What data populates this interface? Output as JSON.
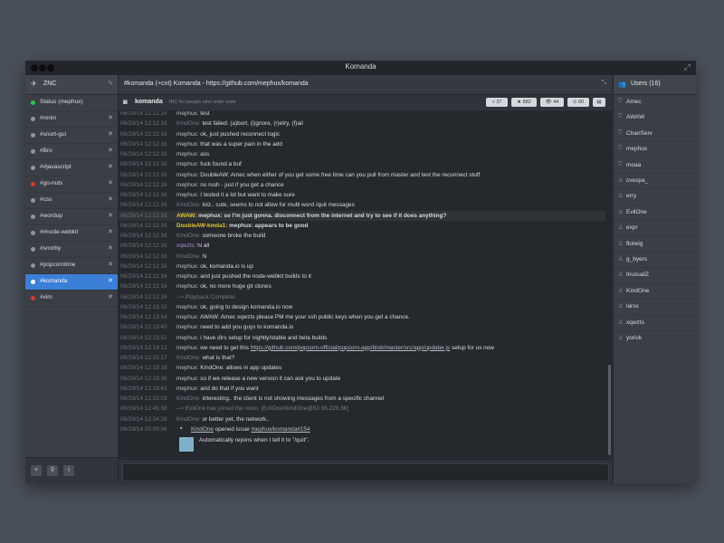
{
  "window": {
    "title": "Komanda"
  },
  "sidebar": {
    "network": {
      "label": "ZNC"
    },
    "channels": [
      {
        "label": "Status (mephux)",
        "dot": "#2ec44a",
        "close": "",
        "active": false
      },
      {
        "label": "#ronin",
        "dot": "#8f969c",
        "close": "✕",
        "active": false
      },
      {
        "label": "#snort-gui",
        "dot": "#8f969c",
        "close": "✕",
        "active": false
      },
      {
        "label": "#Bro",
        "dot": "#8f969c",
        "close": "✕",
        "active": false
      },
      {
        "label": "##javascript",
        "dot": "#8f969c",
        "close": "✕",
        "active": false
      },
      {
        "label": "#go-nuts",
        "dot": "#d8392b",
        "close": "✕",
        "active": false
      },
      {
        "label": "#css",
        "dot": "#8f969c",
        "close": "✕",
        "active": false
      },
      {
        "label": "#wordup",
        "dot": "#8f969c",
        "close": "✕",
        "active": false
      },
      {
        "label": "##node-webkit",
        "dot": "#8f969c",
        "close": "✕",
        "active": false
      },
      {
        "label": "#snorby",
        "dot": "#8f969c",
        "close": "✕",
        "active": false
      },
      {
        "label": "#popcorntime",
        "dot": "#8f969c",
        "close": "✕",
        "active": false
      },
      {
        "label": "#komanda",
        "dot": "#ffffff",
        "close": "✕",
        "active": true
      },
      {
        "label": "#vim",
        "dot": "#d8392b",
        "close": "✕",
        "active": false
      }
    ],
    "footer_buttons": [
      "+",
      "⚲",
      "i"
    ]
  },
  "topic": {
    "text": "#komanda (+cnt) Komanda - https://github.com/mephux/komanda"
  },
  "github": {
    "name": "komanda",
    "description": "IRC for people who write code",
    "stats": [
      {
        "icon": "⑂",
        "value": "37"
      },
      {
        "icon": "★",
        "value": "882"
      },
      {
        "icon": "👁",
        "value": "44"
      },
      {
        "icon": "⊙",
        "value": "60"
      },
      {
        "icon": "▤",
        "value": ""
      }
    ]
  },
  "messages": [
    {
      "ts": "06/29/14 12:12:16",
      "nick": "mephux:",
      "text": "test"
    },
    {
      "ts": "06/29/14 12:12:16",
      "nick": "KindOne:",
      "text": "test failed. (a)bort, (i)gnore, (r)etry, (f)ail",
      "muted_nick": true
    },
    {
      "ts": "06/29/14 12:12:16",
      "nick": "mephux:",
      "text": "ok, just pushed reconnect logic"
    },
    {
      "ts": "06/29/14 12:12:16",
      "nick": "mephux:",
      "text": "that was a super pain in the add"
    },
    {
      "ts": "06/29/14 12:12:16",
      "nick": "mephux:",
      "text": "ass"
    },
    {
      "ts": "06/29/14 12:12:16",
      "nick": "mephux:",
      "text": "fuck found a buf"
    },
    {
      "ts": "06/29/14 12:12:16",
      "nick": "mephux:",
      "text": "DoubleAW: Amec when either of you get some free time can you pull from master and test the reconnect stuff"
    },
    {
      "ts": "06/29/14 12:12:16",
      "nick": "mephux:",
      "text": "no rush - just if you get a chance"
    },
    {
      "ts": "06/29/14 12:12:16",
      "nick": "mephux:",
      "text": "I tested it a lot but want to make sure"
    },
    {
      "ts": "06/29/14 12:12:16",
      "nick": "KindOne:",
      "text": "lolz.. cute, seems to not allow for multi word /quit messages",
      "muted_nick": true
    },
    {
      "ts": "06/29/14 12:12:16",
      "nick": "AWAW:",
      "text": "mephux: so I'm just gonna. disconnect from the internet and try to see if it does anything?",
      "yellow": true,
      "hl": true
    },
    {
      "ts": "06/29/14 12:12:16",
      "nick": "DoubleAW-kmda1:",
      "text": "mephux: appears to be good",
      "yellow": true
    },
    {
      "ts": "06/29/14 12:12:16",
      "nick": "KindOne:",
      "text": "someone broke the build",
      "muted_nick": true
    },
    {
      "ts": "06/29/14 12:12:16",
      "nick": "xqwzts:",
      "text": "hi all",
      "purple": true
    },
    {
      "ts": "06/29/14 12:12:16",
      "nick": "KindOne:",
      "text": "hi",
      "muted_nick": true
    },
    {
      "ts": "06/29/14 12:12:16",
      "nick": "mephux:",
      "text": "ok, komanda.io is up"
    },
    {
      "ts": "06/29/14 12:12:16",
      "nick": "mephux:",
      "text": "and just pushed the node-webkit builds to it"
    },
    {
      "ts": "06/29/14 12:12:16",
      "nick": "mephux:",
      "text": "ok, no more huge git clones"
    },
    {
      "ts": "06/29/14 12:12:16",
      "nick": "-->",
      "text": "Playback Complete.",
      "system": true
    },
    {
      "ts": "06/29/14 12:13:10",
      "nick": "mephux:",
      "text": "ok, going to design komanda.io now"
    },
    {
      "ts": "06/29/14 12:13:34",
      "nick": "mephux:",
      "text": "AWAW: Amec xqwzts please PM me your ssh public keys when you get a chance."
    },
    {
      "ts": "06/29/14 12:13:40",
      "nick": "mephux:",
      "text": "need to add you guys to komanda.io"
    },
    {
      "ts": "06/29/14 12:13:51",
      "nick": "mephux:",
      "text": "i have dirs setup for nightly/stable and beta builds"
    },
    {
      "ts": "06/29/14 12:14:12",
      "nick": "mephux:",
      "text_pre": "we need to get this ",
      "link": "https://github.com/popcorn-official/popcorn-app/blob/master/src/app/updater.js",
      "text_post": " setup for us now"
    },
    {
      "ts": "06/29/14 12:15:17",
      "nick": "KindOne:",
      "text": "what is that?",
      "muted_nick": true
    },
    {
      "ts": "06/29/14 12:19:18",
      "nick": "mephux:",
      "text": "KindOne: allows in app updates"
    },
    {
      "ts": "06/29/14 12:19:36",
      "nick": "mephux:",
      "text": "so if we release a new version it can ask you to update"
    },
    {
      "ts": "06/29/14 12:19:42",
      "nick": "mephux:",
      "text": "and do that if you want"
    },
    {
      "ts": "06/29/14 12:23:03",
      "nick": "KindOne:",
      "text": "interesting.. the client is not showing messages from a specific channel",
      "muted_nick": true
    },
    {
      "ts": "06/29/14 12:45:38",
      "nick": "-->",
      "text": "EvilOne has joined the room. [EvilOne!KindOne@50.96.228.36]",
      "system": true
    },
    {
      "ts": "06/29/14 12:54:26",
      "nick": "KindOne:",
      "text": "or better yet, the network..",
      "muted_nick": true
    }
  ],
  "issue": {
    "ts": "06/29/14 05:09:56",
    "user": "KindOne",
    "action": "opened issue",
    "ref": "mephux/komanda#154",
    "body": "Automatically rejoins when I tell it to \"/quit\"."
  },
  "users": {
    "header": "Users (16)",
    "list": [
      {
        "name": "Amec",
        "icon": "⛉"
      },
      {
        "name": "AWAW",
        "icon": "⛉"
      },
      {
        "name": "ChanServ",
        "icon": "⛉"
      },
      {
        "name": "mephux",
        "icon": "⛉"
      },
      {
        "name": "moaa",
        "icon": "⛉"
      },
      {
        "name": "cvespa_",
        "icon": "♙"
      },
      {
        "name": "erry",
        "icon": "♙"
      },
      {
        "name": "EvilOne",
        "icon": "♙"
      },
      {
        "name": "expr",
        "icon": "♙"
      },
      {
        "name": "flotwig",
        "icon": "♙"
      },
      {
        "name": "g_byers",
        "icon": "♙"
      },
      {
        "name": "InusualZ",
        "icon": "♙"
      },
      {
        "name": "KindOne",
        "icon": "♙"
      },
      {
        "name": "larsx",
        "icon": "♙"
      },
      {
        "name": "xqwzts",
        "icon": "♙"
      },
      {
        "name": "yorick",
        "icon": "♙"
      }
    ]
  }
}
